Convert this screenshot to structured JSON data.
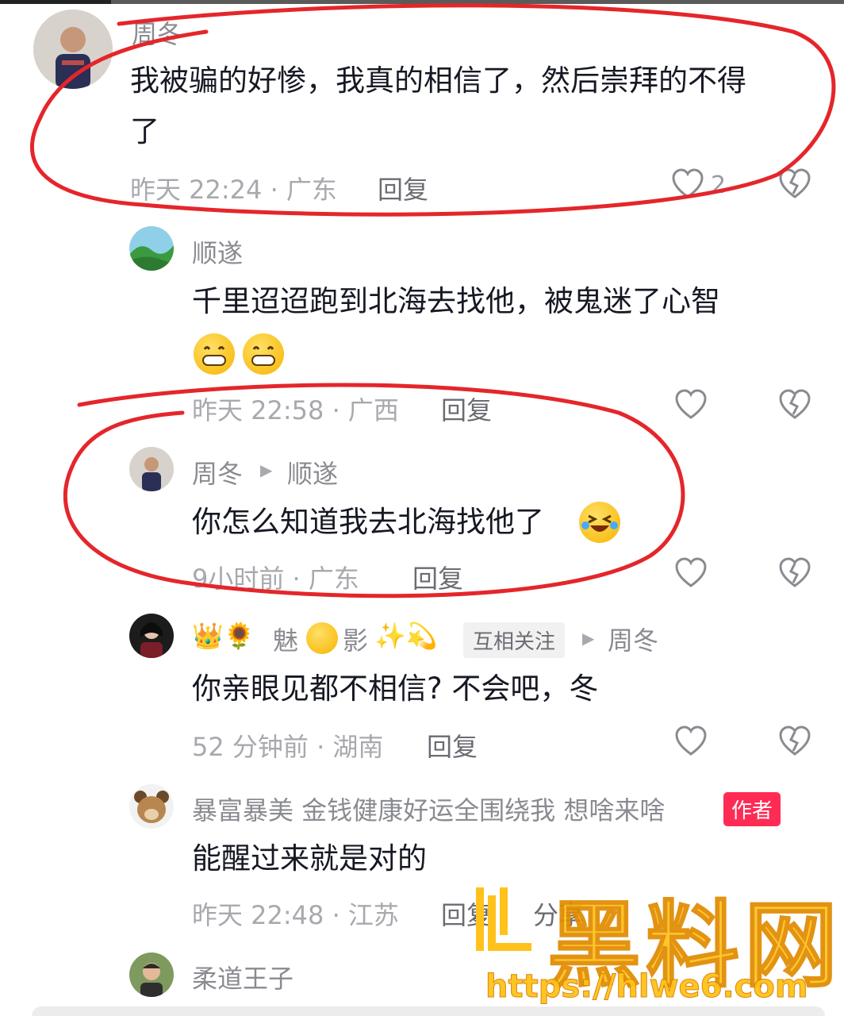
{
  "comments": [
    {
      "user": "周冬",
      "text_line1": "我被骗的好惨，我真的相信了，然后崇拜的不得",
      "text_line2": "了",
      "time": "昨天 22:24 · 广东",
      "reply": "回复",
      "likes": "2"
    },
    {
      "user": "顺遂",
      "text": "千里迢迢跑到北海去找他，被鬼迷了心智",
      "time": "昨天 22:58 · 广西",
      "reply": "回复"
    },
    {
      "user": "周冬",
      "reply_to": "顺遂",
      "text": "你怎么知道我去北海找他了",
      "time": "9小时前 · 广东",
      "reply": "回复"
    },
    {
      "user_prefix": "👑🌻",
      "user_mid1": "魅",
      "user_mid2": "影",
      "user_suffix": "✨💫",
      "tag": "互相关注",
      "reply_to": "周冬",
      "text": "你亲眼见都不相信? 不会吧，冬",
      "time": "52 分钟前 · 湖南",
      "reply": "回复"
    },
    {
      "user": "暴富暴美 金钱健康好运全围绕我 想啥来啥",
      "tag": "作者",
      "text": "能醒过来就是对的",
      "time": "昨天 22:48 · 江苏",
      "reply": "回复",
      "share": "分享"
    },
    {
      "user": "柔道王子"
    }
  ],
  "watermark": {
    "logo_text": "HL",
    "title": "黑料网",
    "url": "https://hlwe6.com"
  },
  "colors": {
    "annotation_red": "#e4262b",
    "author_tag": "#fe2c55",
    "watermark_gold": "#ffc21a"
  }
}
